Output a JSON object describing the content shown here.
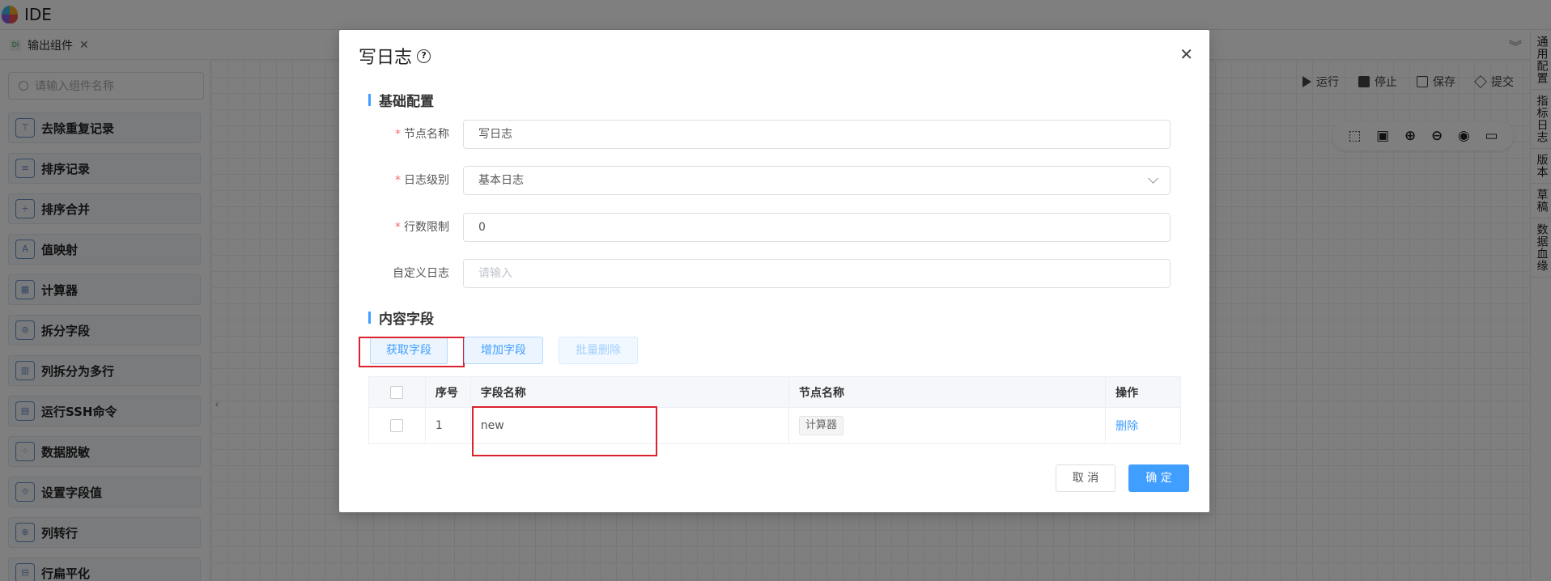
{
  "app": {
    "title": "IDE"
  },
  "tab": {
    "label": "输出组件",
    "icon_text": "DI"
  },
  "sidebar": {
    "search_placeholder": "请输入组件名称",
    "items": [
      {
        "label": "去除重复记录"
      },
      {
        "label": "排序记录"
      },
      {
        "label": "排序合并"
      },
      {
        "label": "值映射"
      },
      {
        "label": "计算器"
      },
      {
        "label": "拆分字段"
      },
      {
        "label": "列拆分为多行"
      },
      {
        "label": "运行SSH命令"
      },
      {
        "label": "数据脱敏"
      },
      {
        "label": "设置字段值"
      },
      {
        "label": "列转行"
      },
      {
        "label": "行扁平化"
      }
    ]
  },
  "toolbar": {
    "run": "运行",
    "stop": "停止",
    "save": "保存",
    "submit": "提交"
  },
  "right_rail": {
    "items": [
      "通用配置",
      "指标日志",
      "版本",
      "草稿",
      "数据血缘"
    ]
  },
  "modal": {
    "title": "写日志",
    "section_basic": "基础配置",
    "section_fields": "内容字段",
    "form": {
      "node_name": {
        "label": "节点名称",
        "value": "写日志"
      },
      "log_level": {
        "label": "日志级别",
        "value": "基本日志"
      },
      "row_limit": {
        "label": "行数限制",
        "value": "0"
      },
      "custom_log": {
        "label": "自定义日志",
        "placeholder": "请输入"
      }
    },
    "buttons": {
      "get_fields": "获取字段",
      "add_field": "增加字段",
      "batch_delete": "批量删除",
      "cancel": "取 消",
      "confirm": "确 定"
    },
    "table": {
      "headers": {
        "index": "序号",
        "field_name": "字段名称",
        "node_name": "节点名称",
        "action": "操作"
      },
      "rows": [
        {
          "index": "1",
          "field_name": "new",
          "node_name": "计算器",
          "action": "删除"
        }
      ]
    }
  },
  "colors": {
    "primary": "#409eff",
    "highlight": "#d9232e",
    "required": "#f56c6c"
  }
}
